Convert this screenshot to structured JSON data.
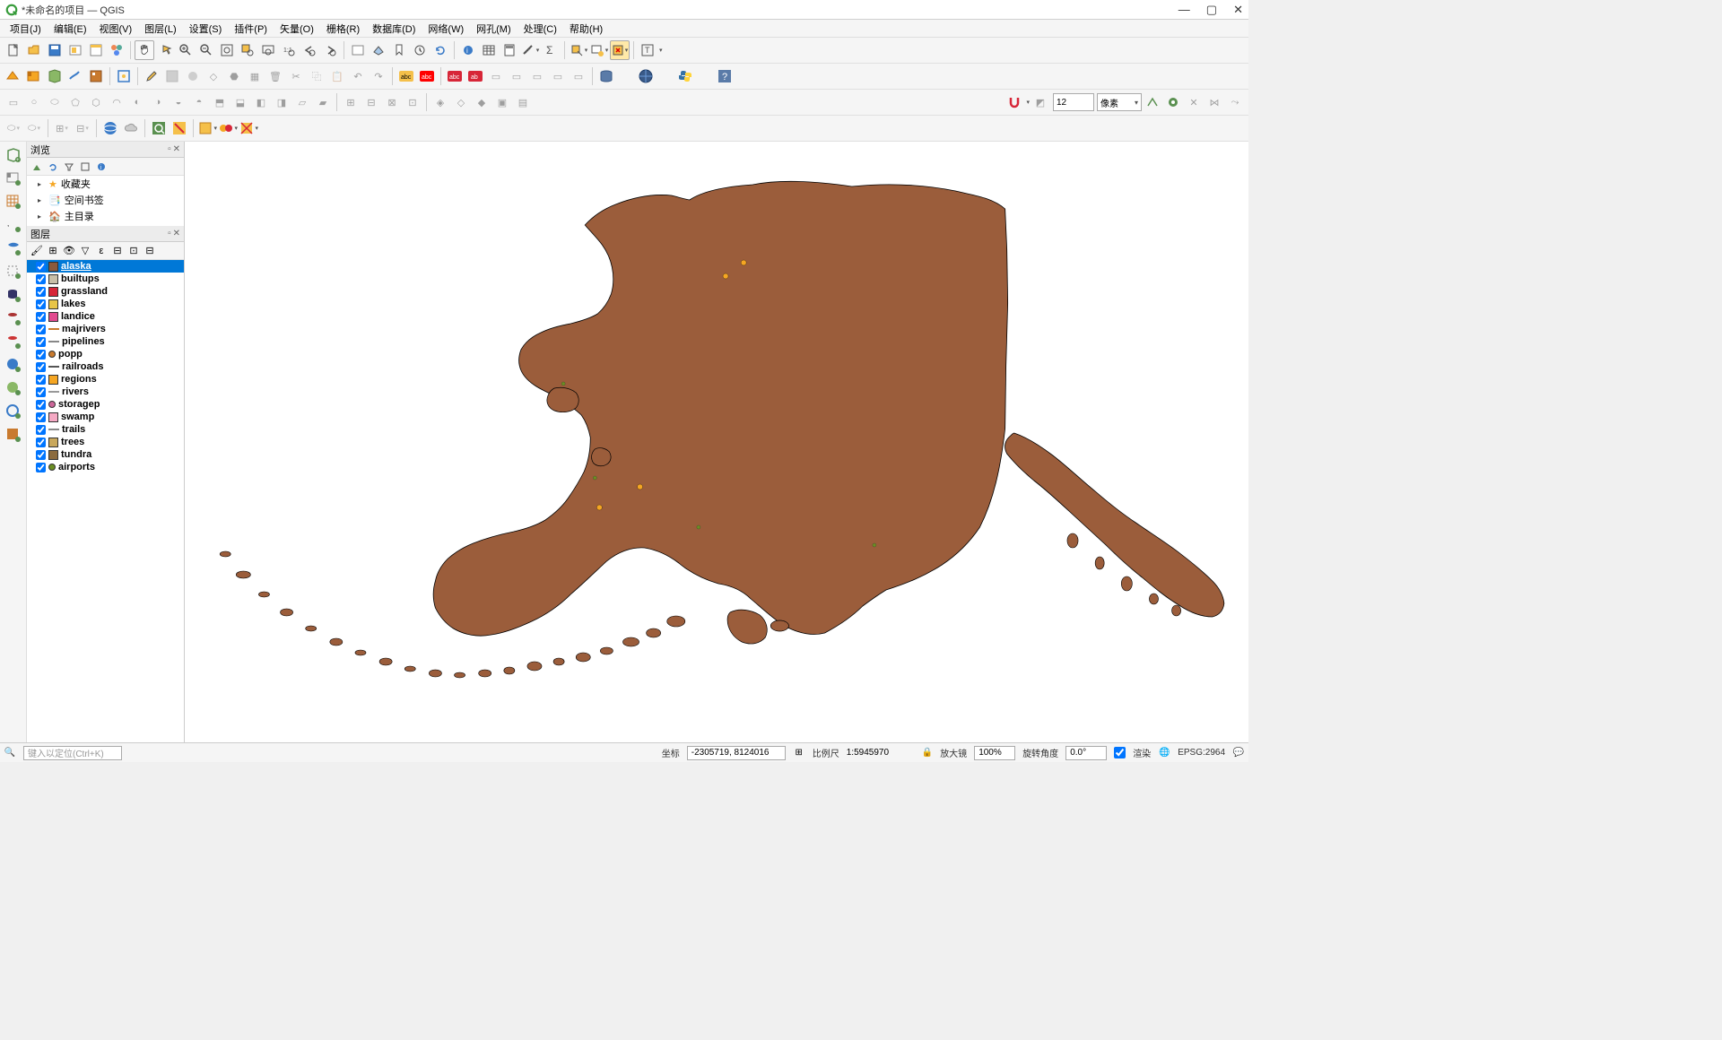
{
  "window": {
    "title": "*未命名的项目 — QGIS"
  },
  "menu": {
    "project": "项目(J)",
    "edit": "编辑(E)",
    "view": "视图(V)",
    "layer": "图层(L)",
    "settings": "设置(S)",
    "plugins": "插件(P)",
    "vector": "矢量(O)",
    "raster": "栅格(R)",
    "database": "数据库(D)",
    "web": "网络(W)",
    "mesh": "网孔(M)",
    "processing": "处理(C)",
    "help": "帮助(H)"
  },
  "panels": {
    "browser_title": "浏览",
    "layers_title": "图层",
    "browser_items": {
      "favorites": "收藏夹",
      "spatial_bookmarks": "空间书签",
      "home": "主目录"
    }
  },
  "layers": [
    {
      "name": "alaska",
      "color": "#8b5a3c",
      "type": "poly",
      "selected": true
    },
    {
      "name": "builtups",
      "color": "#c8bfa8",
      "type": "poly"
    },
    {
      "name": "grassland",
      "color": "#d72638",
      "type": "poly"
    },
    {
      "name": "lakes",
      "color": "#e8c547",
      "type": "poly"
    },
    {
      "name": "landice",
      "color": "#e24a8f",
      "type": "poly"
    },
    {
      "name": "majrivers",
      "color": "#c97a2e",
      "type": "line"
    },
    {
      "name": "pipelines",
      "color": "#888888",
      "type": "line"
    },
    {
      "name": "popp",
      "color": "#c97a2e",
      "type": "point"
    },
    {
      "name": "railroads",
      "color": "#555555",
      "type": "line"
    },
    {
      "name": "regions",
      "color": "#f5a623",
      "type": "poly"
    },
    {
      "name": "rivers",
      "color": "#999999",
      "type": "line"
    },
    {
      "name": "storagep",
      "color": "#cc6699",
      "type": "point"
    },
    {
      "name": "swamp",
      "color": "#f5a9c4",
      "type": "poly"
    },
    {
      "name": "trails",
      "color": "#888888",
      "type": "line"
    },
    {
      "name": "trees",
      "color": "#c9a85c",
      "type": "poly"
    },
    {
      "name": "tundra",
      "color": "#8b6b3e",
      "type": "poly"
    },
    {
      "name": "airports",
      "color": "#6b8e23",
      "type": "point"
    }
  ],
  "toolbar3": {
    "vertex_count": "12",
    "pixel_label": "像素"
  },
  "statusbar": {
    "locator_prompt": "键入以定位(Ctrl+K)",
    "coord_label": "坐标",
    "coord_value": "-2305719, 8124016",
    "scale_label": "比例尺",
    "scale_value": "1:5945970",
    "magnifier_label": "放大镜",
    "magnifier_value": "100%",
    "rotation_label": "旋转角度",
    "rotation_value": "0.0°",
    "render_label": "渲染",
    "crs_label": "EPSG:2964"
  }
}
